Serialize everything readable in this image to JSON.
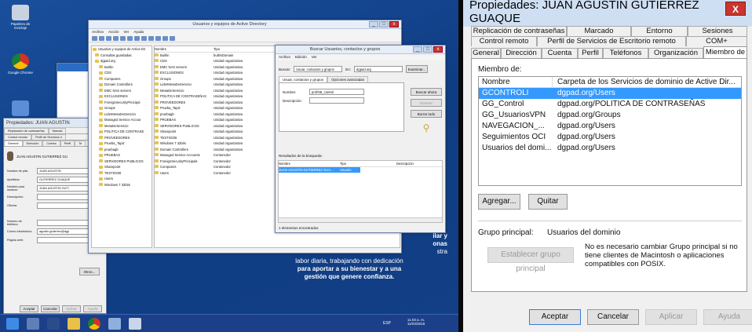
{
  "desktop": {
    "icons": [
      "Papelera de reciclaje",
      "Google Chrome",
      "Panel de control"
    ],
    "overlay_text": {
      "line1": "ilar y",
      "line2": "onas",
      "line3": "stra",
      "line4": "labor diaria, trabajando con dedicación",
      "line5": "para aportar a su bienestar y a una",
      "line6": "gestión que genere confianza."
    },
    "clock": {
      "time": "11:03 a. m.",
      "date": "11/03/2019",
      "lang": "ESP"
    }
  },
  "aduc": {
    "title": "Usuarios y equipos de Active Directory",
    "menu": [
      "Archivo",
      "Acción",
      "Ver",
      "Ayuda"
    ],
    "tree": [
      "Usuarios y equipos de Active Dir",
      "Consultas guardadas",
      "dgpad.org",
      "Builtin",
      "CDS",
      "Computers",
      "Domain Controllers",
      "EMC NAS servers",
      "EXCLUSIONES",
      "ForeignSecurityPrincipal",
      "Groups",
      "LiderMesaDeServicio",
      "Managed Service Accour",
      "MesaDeServicio",
      "POLITICA DE CONTRASE",
      "PROVEEDORES",
      "Prueba_Tapiz",
      "pruebagb",
      "PRUEBAS",
      "SERVIDORES PUBLICOS",
      "Sharepoint",
      "TESTIGOB",
      "Users",
      "Windows 7 32bits"
    ],
    "columns": [
      "Nombre",
      "Tipo"
    ],
    "rows": [
      [
        "Builtin",
        "builtinDomain"
      ],
      [
        "CDS",
        "Unidad organizativa"
      ],
      [
        "EMC NAS servers",
        "Unidad organizativa"
      ],
      [
        "EXCLUSIONES",
        "Unidad organizativa"
      ],
      [
        "Groups",
        "Unidad organizativa"
      ],
      [
        "LiderMesaDeServicio",
        "Unidad organizativa"
      ],
      [
        "MesaDeServicio",
        "Unidad organizativa"
      ],
      [
        "POLITICA DE CONTRASEÑAS",
        "Unidad organizativa"
      ],
      [
        "PROVEEDORES",
        "Unidad organizativa"
      ],
      [
        "Prueba_Tapiz",
        "Unidad organizativa"
      ],
      [
        "pruebagb",
        "Unidad organizativa"
      ],
      [
        "PRUEBAS",
        "Unidad organizativa"
      ],
      [
        "SERVIDORES PUBLICOS",
        "Unidad organizativa"
      ],
      [
        "Sharepoint",
        "Unidad organizativa"
      ],
      [
        "TESTIGOB",
        "Unidad organizativa"
      ],
      [
        "Windows 7 32bits",
        "Unidad organizativa"
      ],
      [
        "Domain Controllers",
        "Unidad organizativa"
      ],
      [
        "Managed Service Accounts",
        "Contenedor"
      ],
      [
        "ForeignSecurityPrincipals",
        "Contenedor"
      ],
      [
        "Computers",
        "Contenedor"
      ],
      [
        "Users",
        "Contenedor"
      ]
    ]
  },
  "search": {
    "title": "Buscar Usuarios, contactos y grupos",
    "menu": [
      "Archivo",
      "Edición",
      "Ver"
    ],
    "find_label": "Buscar:",
    "find_value": "Usuar, contactos y grupos",
    "in_label": "En:",
    "in_value": "dgpad.org",
    "browse": "Examinar...",
    "tabs": [
      "Usuar, contactos y grupos",
      "Opciones avanzadas"
    ],
    "name_label": "Nombre:",
    "name_value": "profOB_control",
    "desc_label": "Descripción:",
    "btn_find": "Buscar ahora",
    "btn_stop": "Detener",
    "btn_clear": "Borrar todo",
    "results_label": "Resultados de la búsqueda:",
    "res_cols": [
      "Nombre",
      "Tipo",
      "Descripción"
    ],
    "res_row": [
      "JUAN AGUSTIN GUTIERREZ GUA...",
      "Usuario",
      ""
    ],
    "status": "1 elementos encontrados"
  },
  "small_props": {
    "title": "Propiedades: JUAN AGUSTIN",
    "tabs_row1": [
      "Replicación de contraseñas",
      "Marcad"
    ],
    "tabs_row2": [
      "Control remoto",
      "Perfil de Servicios d"
    ],
    "tabs_row3": [
      "General",
      "Dirección",
      "Cuenta",
      "Perfil",
      "Te"
    ],
    "user": "JUAN AGUSTIN GUTIERREZ GU",
    "fields": [
      {
        "label": "Nombre de pila:",
        "value": "JUAN AGUSTIN"
      },
      {
        "label": "Apellidos:",
        "value": "GUTIERREZ GUAQUE"
      },
      {
        "label": "Nombre para mostrar:",
        "value": "JUAN AGUSTIN GUTI"
      },
      {
        "label": "Descripción:",
        "value": ""
      },
      {
        "label": "Oficina:",
        "value": ""
      },
      {
        "label": "Número de teléfono:",
        "value": ""
      },
      {
        "label": "Correo electrónico:",
        "value": "agustin.gutierrez@dgp"
      },
      {
        "label": "Página web:",
        "value": ""
      }
    ],
    "btn_other": "Otros...",
    "buttons": [
      "Aceptar",
      "Cancelar",
      "Aplicar",
      "Ayuda"
    ]
  },
  "dialog": {
    "title": "Propiedades: JUAN AGUSTIN GUTIERREZ GUAQUE",
    "close": "X",
    "tabs_row1": [
      "Replicación de contraseñas",
      "Marcado",
      "Entorno",
      "Sesiones"
    ],
    "tabs_row2": [
      "Control remoto",
      "Perfil de Servicios de Escritorio remoto",
      "COM+"
    ],
    "tabs_row3": [
      "General",
      "Dirección",
      "Cuenta",
      "Perfil",
      "Teléfonos",
      "Organización",
      "Miembro de"
    ],
    "member_of_label": "Miembro de:",
    "columns": [
      "Nombre",
      "Carpeta de los Servicios de dominio de Active Dir..."
    ],
    "rows": [
      [
        "GCONTROLI",
        "dgpad.org/Users"
      ],
      [
        "GG_Control",
        "dgpad.org/POLITICA DE CONTRASEÑAS"
      ],
      [
        "GG_UsuariosVPN",
        "dgpad.org/Groups"
      ],
      [
        "NAVEGACION_...",
        "dgpad.org/Users"
      ],
      [
        "Seguimientos OCI",
        "dgpad.org/Users"
      ],
      [
        "Usuarios del domi...",
        "dgpad.org/Users"
      ]
    ],
    "selected_row": 0,
    "btn_add": "Agregar...",
    "btn_remove": "Quitar",
    "primary_group_label": "Grupo principal:",
    "primary_group_value": "Usuarios del dominio",
    "btn_set_primary": "Establecer grupo principal",
    "primary_note": "No es necesario cambiar Grupo principal si no tiene clientes de Macintosh o aplicaciones compatibles con POSIX.",
    "buttons": [
      "Aceptar",
      "Cancelar",
      "Aplicar",
      "Ayuda"
    ]
  }
}
